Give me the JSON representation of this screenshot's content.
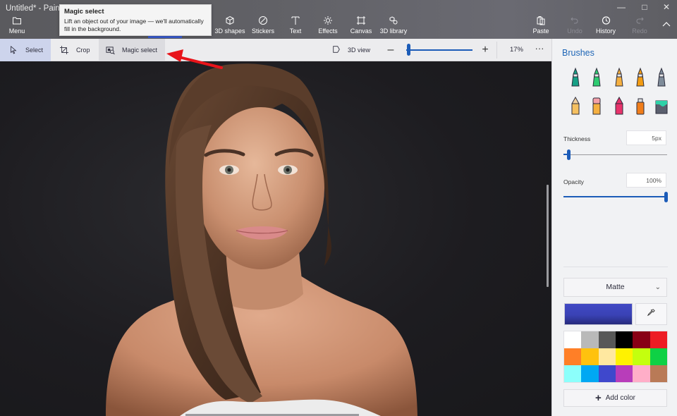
{
  "window": {
    "title": "Untitled* - Paint 3D",
    "minimize_icon": "minimize-icon",
    "maximize_icon": "maximize-icon",
    "close_icon": "close-icon"
  },
  "ribbon": {
    "menu": {
      "label": "Menu",
      "icon": "folder-icon"
    },
    "tabs": [
      {
        "label": "3D shapes",
        "icon": "cube-icon"
      },
      {
        "label": "Stickers",
        "icon": "sticker-icon"
      },
      {
        "label": "Text",
        "icon": "text-icon"
      },
      {
        "label": "Effects",
        "icon": "sun-icon"
      },
      {
        "label": "Canvas",
        "icon": "canvas-icon"
      },
      {
        "label": "3D library",
        "icon": "library-icon"
      }
    ],
    "paste": {
      "label": "Paste",
      "icon": "paste-icon"
    },
    "undo": {
      "label": "Undo",
      "icon": "undo-icon",
      "enabled": false
    },
    "history": {
      "label": "History",
      "icon": "history-icon"
    },
    "redo": {
      "label": "Redo",
      "icon": "redo-icon",
      "enabled": false
    },
    "collapse_icon": "chevron-up-icon"
  },
  "tooltip": {
    "title": "Magic select",
    "body": "Lift an object out of your image — we'll automatically fill in the background."
  },
  "subtoolbar": {
    "select": "Select",
    "crop": "Crop",
    "magic_select": "Magic select",
    "view_3d": "3D view",
    "zoom_percent_label": "17%",
    "zoom_value": 17,
    "more": "···"
  },
  "panel": {
    "title": "Brushes",
    "brushes": [
      {
        "name": "marker",
        "color": "#16a085"
      },
      {
        "name": "calligraphy-pen",
        "color": "#2ecc71"
      },
      {
        "name": "oil-brush",
        "color": "#f5b041"
      },
      {
        "name": "watercolor",
        "color": "#f39c12"
      },
      {
        "name": "pixel-pen",
        "color": "#7f8c9a"
      },
      {
        "name": "pencil",
        "color": "#f0c060"
      },
      {
        "name": "eraser",
        "color": "#f4a0a8"
      },
      {
        "name": "crayon",
        "color": "#e8336b"
      },
      {
        "name": "spray-can",
        "color": "#f07d1a"
      },
      {
        "name": "fill",
        "color": "#2ed1a8"
      }
    ],
    "thickness": {
      "label": "Thickness",
      "value": "5px",
      "fraction": 0.05
    },
    "opacity": {
      "label": "Opacity",
      "value": "100%",
      "fraction": 1.0
    },
    "finish": {
      "selected": "Matte"
    },
    "current_color": "#4049c4",
    "palette": [
      "#ffffff",
      "#b9b9b9",
      "#585858",
      "#000000",
      "#880015",
      "#ed1c24",
      "#ff7f27",
      "#ffc20e",
      "#ffe8a0",
      "#fff200",
      "#c4ff0e",
      "#0ed145",
      "#8cfffb",
      "#00a8f3",
      "#3f48cc",
      "#b83dba",
      "#ffaec8",
      "#b97a57"
    ],
    "add_color": "Add color"
  }
}
